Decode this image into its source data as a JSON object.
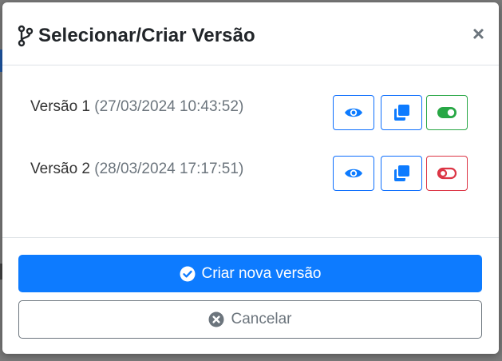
{
  "modal": {
    "title": "Selecionar/Criar Versão",
    "close_label": "×"
  },
  "versions": [
    {
      "label": "Versão 1",
      "date": "(27/03/2024 10:43:52)",
      "active": true
    },
    {
      "label": "Versão 2",
      "date": "(28/03/2024 17:17:51)",
      "active": false
    }
  ],
  "footer": {
    "create_label": "Criar nova versão",
    "cancel_label": "Cancelar"
  },
  "colors": {
    "primary": "#0d7bff",
    "success": "#28a745",
    "danger": "#dc3545",
    "secondary": "#6c757d"
  },
  "icons": {
    "title": "code-branch-icon",
    "view": "eye-icon",
    "copy": "copy-icon",
    "toggle_on": "toggle-on-icon",
    "toggle_off": "toggle-off-icon",
    "create": "check-circle-icon",
    "cancel": "x-circle-icon"
  }
}
